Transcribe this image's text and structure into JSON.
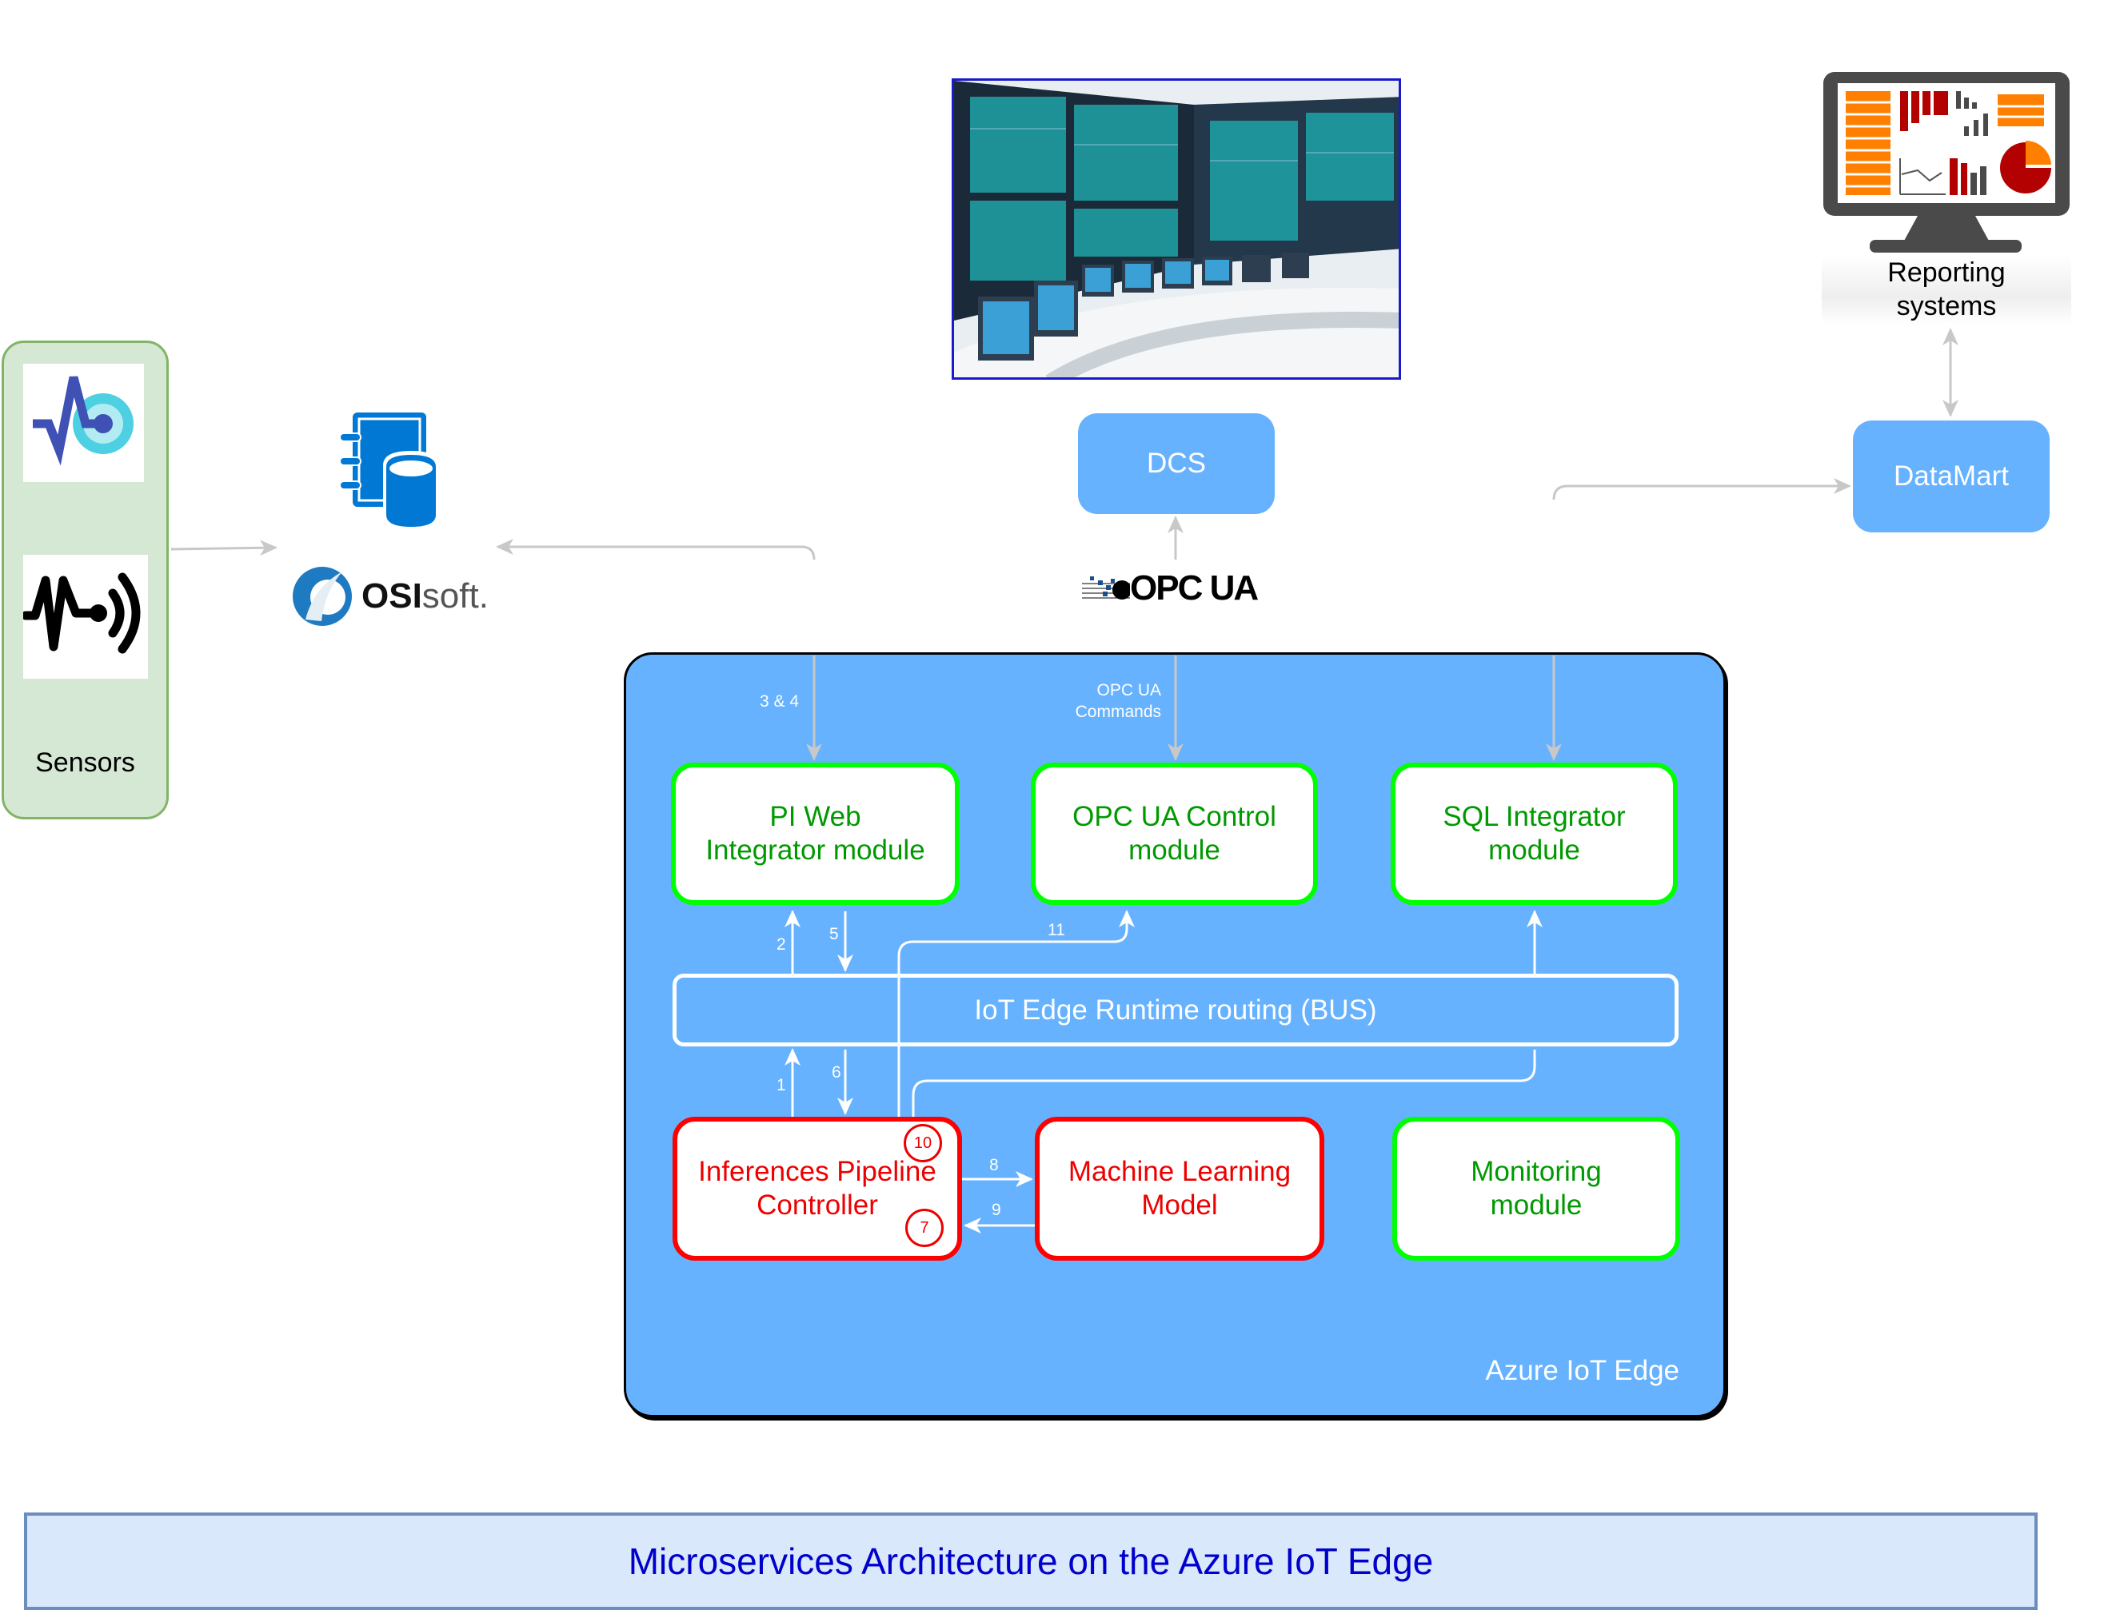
{
  "title": "Microservices Architecture on the Azure IoT Edge",
  "sensors": {
    "label": "Sensors",
    "icons": [
      "sensor-pulse-target-icon",
      "sensor-signal-wave-icon"
    ]
  },
  "osisoft": {
    "icon": "pi-data-archive-icon",
    "logo_bold": "OSI",
    "logo_light": "soft",
    "logo_mark": "."
  },
  "control_room": {
    "image": "control-room-photo"
  },
  "reporting": {
    "icon": "reporting-monitor-icon",
    "label_line1": "Reporting",
    "label_line2": "systems"
  },
  "dcs": {
    "label": "DCS"
  },
  "datamart": {
    "label": "DataMart"
  },
  "opc_logo": {
    "text": "OPC UA"
  },
  "azure_edge": {
    "label": "Azure IoT Edge",
    "edge_labels": {
      "pi_link": "3 & 4",
      "opc_commands_1": "OPC UA",
      "opc_commands_2": "Commands"
    },
    "modules": {
      "pi_web": {
        "line1": "PI Web",
        "line2": "Integrator module"
      },
      "opc_control": {
        "line1": "OPC UA Control",
        "line2": "module"
      },
      "sql": {
        "line1": "SQL Integrator",
        "line2": "module"
      },
      "inferences": {
        "line1": "Inferences Pipeline",
        "line2": "Controller",
        "badge_top": "10",
        "badge_bottom": "7"
      },
      "ml_model": {
        "line1": "Machine Learning",
        "line2": "Model"
      },
      "monitoring": {
        "line1": "Monitoring",
        "line2": "module"
      }
    },
    "bus": {
      "label": "IoT Edge Runtime routing (BUS)"
    },
    "step_labels": {
      "s1": "1",
      "s2": "2",
      "s5": "5",
      "s6": "6",
      "s8": "8",
      "s9": "9",
      "s11": "11"
    }
  },
  "colors": {
    "module_green": "#00ff00",
    "module_red": "#ff0000",
    "azure_blue": "#66b2ff",
    "banner_bg": "#dae8fc",
    "banner_text": "#0000cc"
  }
}
